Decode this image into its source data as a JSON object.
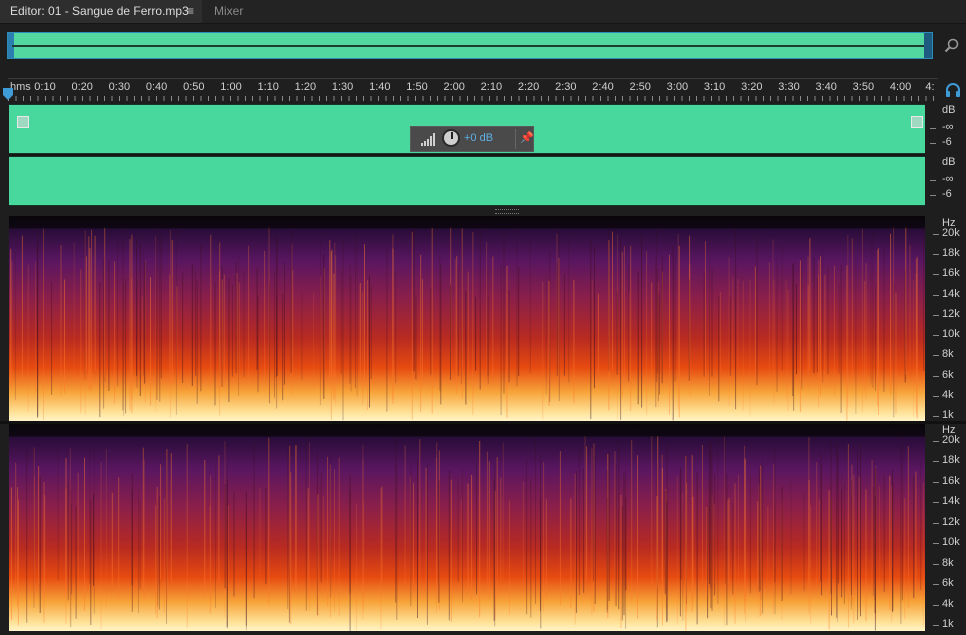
{
  "tabs": {
    "editor_label": "Editor: 01 - Sangue de Ferro.mp3",
    "editor_menu": "≡",
    "mixer_label": "Mixer"
  },
  "ruler": {
    "unit_label": "hms",
    "ticks": [
      "0:10",
      "0:20",
      "0:30",
      "0:40",
      "0:50",
      "1:00",
      "1:10",
      "1:20",
      "1:30",
      "1:40",
      "1:50",
      "2:00",
      "2:10",
      "2:20",
      "2:30",
      "2:40",
      "2:50",
      "3:00",
      "3:10",
      "3:20",
      "3:30",
      "3:40",
      "3:50",
      "4:00",
      "4:"
    ]
  },
  "hud": {
    "volume_value": "+0 dB"
  },
  "db_scale": {
    "ch1": [
      "dB",
      "-∞",
      "-6"
    ],
    "ch2": [
      "dB",
      "-∞",
      "-6"
    ]
  },
  "spectral": {
    "ch1_labels": [
      "Hz",
      "20k",
      "18k",
      "16k",
      "14k",
      "12k",
      "10k",
      "8k",
      "6k",
      "4k",
      "1k"
    ],
    "ch2_labels": [
      "Hz",
      "20k",
      "18k",
      "16k",
      "14k",
      "12k",
      "10k",
      "8k",
      "6k",
      "4k",
      "1k"
    ]
  },
  "colors": {
    "waveform": "#48d89d",
    "overview": "#52d7a0",
    "accent": "#2d8bb8",
    "hud_value": "#5fb0e8"
  },
  "icons": {
    "zoom": "zoom-magnifier-icon",
    "headphones": "headphones-icon",
    "pin": "pin-icon",
    "playhead": "playhead-marker-icon"
  }
}
